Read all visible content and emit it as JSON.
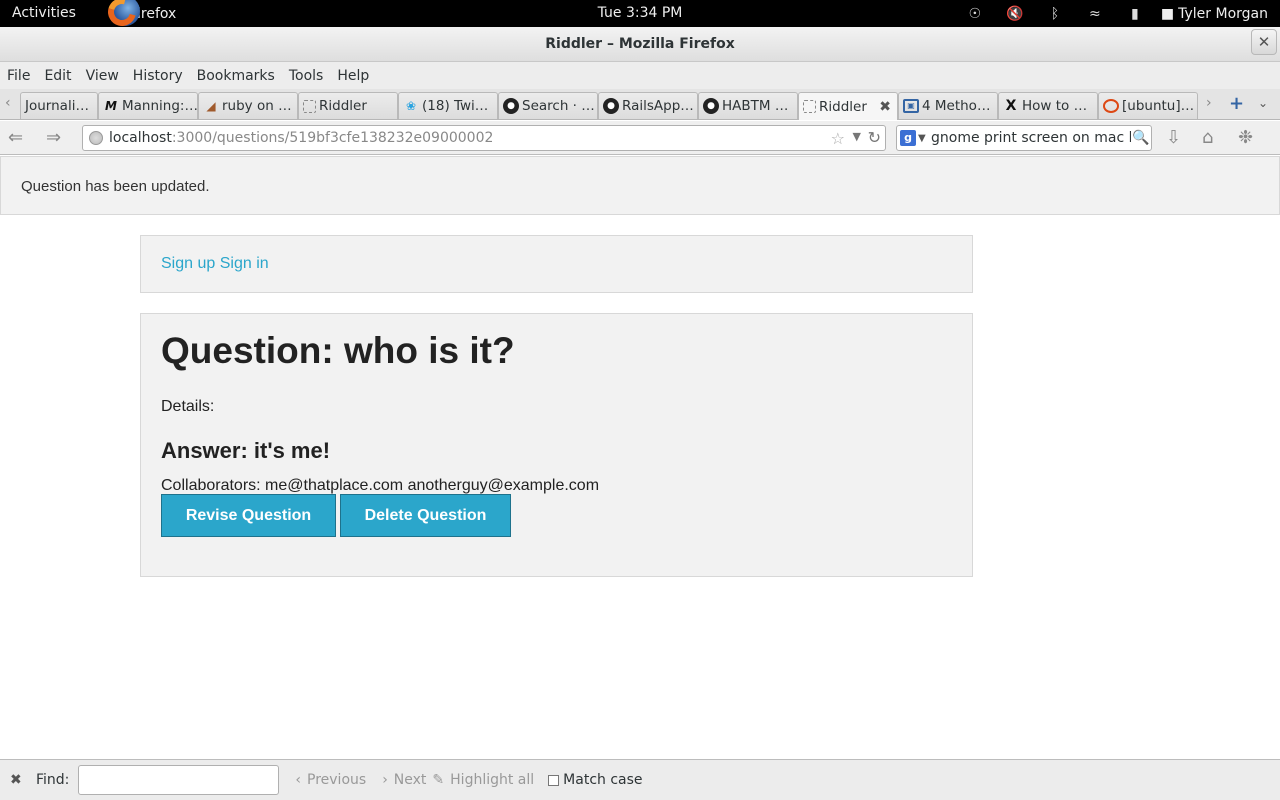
{
  "system": {
    "activities": "Activities",
    "app_name": "Firefox",
    "clock": "Tue  3:34 PM",
    "user": "Tyler Morgan",
    "status_icons": [
      "accessibility-icon",
      "volume-muted-icon",
      "bluetooth-icon",
      "wifi-icon",
      "battery-icon"
    ]
  },
  "window": {
    "title": "Riddler – Mozilla Firefox",
    "close_glyph": "✕"
  },
  "menu": [
    "File",
    "Edit",
    "View",
    "History",
    "Bookmarks",
    "Tools",
    "Help"
  ],
  "tabs": [
    {
      "label": "Journali…",
      "icon": "none"
    },
    {
      "label": "Manning:…",
      "icon": "manning-icon"
    },
    {
      "label": "ruby on …",
      "icon": "ruby-shoe-icon"
    },
    {
      "label": "Riddler",
      "icon": "page-icon"
    },
    {
      "label": "(18) Twi…",
      "icon": "twitter-icon"
    },
    {
      "label": "Search · …",
      "icon": "github-icon"
    },
    {
      "label": "RailsApp…",
      "icon": "github-icon"
    },
    {
      "label": "HABTM …",
      "icon": "github-icon"
    },
    {
      "label": "Riddler",
      "icon": "page-icon",
      "active": true
    },
    {
      "label": "4 Metho…",
      "icon": "blue-square-icon"
    },
    {
      "label": "How to …",
      "icon": "x-icon"
    },
    {
      "label": "[ubuntu]…",
      "icon": "ubuntu-icon"
    }
  ],
  "url": {
    "host": "localhost",
    "path": ":3000/questions/519bf3cfe138232e09000002"
  },
  "search": {
    "query": "gnome print screen on mac keyb"
  },
  "page": {
    "notice": "Question has been updated.",
    "sign_up": "Sign up",
    "sign_in": "Sign in",
    "heading": "Question: who is it?",
    "details": "Details:",
    "answer": "Answer: it's me!",
    "collaborators": "Collaborators: me@thatplace.com anotherguy@example.com",
    "revise_button": "Revise Question",
    "delete_button": "Delete Question"
  },
  "findbar": {
    "label": "Find:",
    "previous": "Previous",
    "next": "Next",
    "highlight_all": "Highlight all",
    "match_case": "Match case"
  },
  "colors": {
    "link": "#2ba6cb",
    "button": "#2ba6cb",
    "panel_bg": "#f2f2f2"
  }
}
